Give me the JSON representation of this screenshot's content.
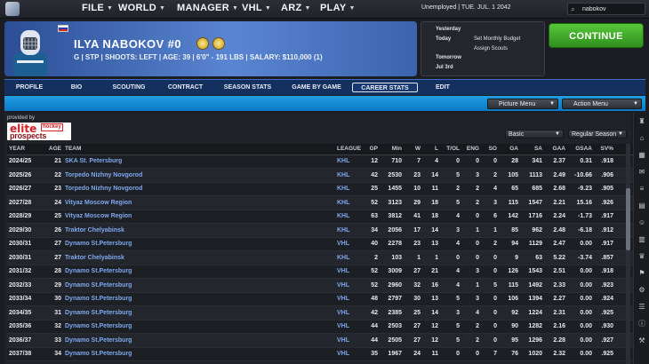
{
  "menu": {
    "items": [
      "FILE",
      "WORLD",
      "MANAGER",
      "VHL",
      "ARZ",
      "PLAY"
    ],
    "status": "Unemployed | TUE. JUL. 1 2042",
    "search_value": "nabokov"
  },
  "player": {
    "name": "ILYA NABOKOV #0",
    "details": "G | STP | SHOOTS: LEFT | AGE: 39 | 6'0\" - 191 LBS | SALARY: $110,000 (1)"
  },
  "calendar": {
    "yesterday_label": "Yesterday",
    "today_label": "Today",
    "today_items": [
      "Set Monthly Budget",
      "Assign Scouts"
    ],
    "tomorrow_label": "Tomorrow",
    "tomorrow_date": "Jul 3rd"
  },
  "continue_label": "CONTINUE",
  "tabs": [
    "PROFILE",
    "BIO",
    "SCOUTING",
    "CONTRACT",
    "SEASON STATS",
    "GAME BY GAME",
    "CAREER STATS",
    "EDIT"
  ],
  "active_tab": "CAREER STATS",
  "submenu": {
    "picture_menu": "Picture Menu",
    "action_menu": "Action Menu"
  },
  "provided_by": "provided by",
  "ep_logo": {
    "elite": "elite",
    "hockey": "hockey",
    "prospects": "prospects"
  },
  "filters": {
    "stat_type": "Basic",
    "season_type": "Regular Season"
  },
  "table": {
    "headers": [
      "YEAR",
      "AGE",
      "TEAM",
      "LEAGUE",
      "GP",
      "Min",
      "W",
      "L",
      "T/OL",
      "ENG",
      "SO",
      "GA",
      "SA",
      "GAA",
      "GSAA",
      "SV%",
      "GR"
    ],
    "rows": [
      [
        "2024/25",
        "21",
        "SKA St. Petersburg",
        "KHL",
        "12",
        "710",
        "7",
        "4",
        "0",
        "0",
        "0",
        "28",
        "341",
        "2.37",
        "0.31",
        ".918",
        "68"
      ],
      [
        "2025/26",
        "22",
        "Torpedo Nizhny Novgorod",
        "KHL",
        "42",
        "2530",
        "23",
        "14",
        "5",
        "3",
        "2",
        "105",
        "1113",
        "2.49",
        "-10.66",
        ".906",
        "69"
      ],
      [
        "2026/27",
        "23",
        "Torpedo Nizhny Novgorod",
        "KHL",
        "25",
        "1455",
        "10",
        "11",
        "2",
        "2",
        "4",
        "65",
        "685",
        "2.68",
        "-9.23",
        ".905",
        "68"
      ],
      [
        "2027/28",
        "24",
        "Vityaz Moscow Region",
        "KHL",
        "52",
        "3123",
        "29",
        "18",
        "5",
        "2",
        "3",
        "115",
        "1547",
        "2.21",
        "15.16",
        ".926",
        "74"
      ],
      [
        "2028/29",
        "25",
        "Vityaz Moscow Region",
        "KHL",
        "63",
        "3812",
        "41",
        "18",
        "4",
        "0",
        "6",
        "142",
        "1716",
        "2.24",
        "-1.73",
        ".917",
        "71"
      ],
      [
        "2029/30",
        "26",
        "Traktor Chelyabinsk",
        "KHL",
        "34",
        "2056",
        "17",
        "14",
        "3",
        "1",
        "1",
        "85",
        "962",
        "2.48",
        "-6.18",
        ".912",
        "68"
      ],
      [
        "2030/31",
        "27",
        "Dynamo St.Petersburg",
        "VHL",
        "40",
        "2278",
        "23",
        "13",
        "4",
        "0",
        "2",
        "94",
        "1129",
        "2.47",
        "0.00",
        ".917",
        "75"
      ],
      [
        "2030/31",
        "27",
        "Traktor Chelyabinsk",
        "KHL",
        "2",
        "103",
        "1",
        "1",
        "0",
        "0",
        "0",
        "9",
        "63",
        "5.22",
        "-3.74",
        ".857",
        "58"
      ],
      [
        "2031/32",
        "28",
        "Dynamo St.Petersburg",
        "VHL",
        "52",
        "3009",
        "27",
        "21",
        "4",
        "3",
        "0",
        "126",
        "1543",
        "2.51",
        "0.00",
        ".918",
        "70"
      ],
      [
        "2032/33",
        "29",
        "Dynamo St.Petersburg",
        "VHL",
        "52",
        "2960",
        "32",
        "16",
        "4",
        "1",
        "5",
        "115",
        "1492",
        "2.33",
        "0.00",
        ".923",
        "72"
      ],
      [
        "2033/34",
        "30",
        "Dynamo St.Petersburg",
        "VHL",
        "48",
        "2797",
        "30",
        "13",
        "5",
        "3",
        "0",
        "106",
        "1394",
        "2.27",
        "0.00",
        ".924",
        "74"
      ],
      [
        "2034/35",
        "31",
        "Dynamo St.Petersburg",
        "VHL",
        "42",
        "2385",
        "25",
        "14",
        "3",
        "4",
        "0",
        "92",
        "1224",
        "2.31",
        "0.00",
        ".925",
        "70"
      ],
      [
        "2035/36",
        "32",
        "Dynamo St.Petersburg",
        "VHL",
        "44",
        "2503",
        "27",
        "12",
        "5",
        "2",
        "0",
        "90",
        "1282",
        "2.16",
        "0.00",
        ".930",
        "68"
      ],
      [
        "2036/37",
        "33",
        "Dynamo St.Petersburg",
        "VHL",
        "44",
        "2505",
        "27",
        "12",
        "5",
        "2",
        "0",
        "95",
        "1296",
        "2.28",
        "0.00",
        ".927",
        "68"
      ],
      [
        "2037/38",
        "34",
        "Dynamo St.Petersburg",
        "VHL",
        "35",
        "1967",
        "24",
        "11",
        "0",
        "0",
        "7",
        "76",
        "1020",
        "2.32",
        "0.00",
        ".925",
        "66"
      ]
    ]
  },
  "colors": {
    "accent_green": "#3aa52a",
    "tab_blue": "#14305e",
    "subbar_blue": "#1589d6",
    "link_blue": "#7ea8ee"
  },
  "sidebar_icons": [
    "goalie-icon",
    "home-icon",
    "calendar-icon",
    "mail-icon",
    "list-icon",
    "grid-icon",
    "people-icon",
    "chart-icon",
    "trophy-icon",
    "flag-icon",
    "gear-icon",
    "menu-icon",
    "info-icon",
    "stick-icon"
  ]
}
